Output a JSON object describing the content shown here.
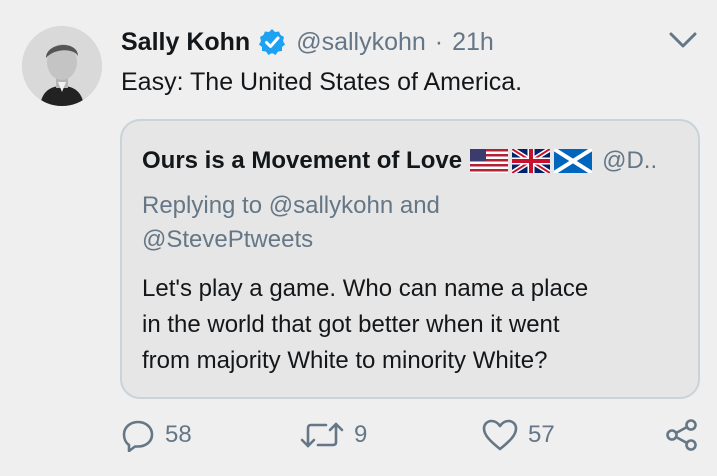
{
  "tweet": {
    "author_name": "Sally Kohn",
    "handle": "@sallykohn",
    "separator": "·",
    "time": "21h",
    "text": "Easy: The United States of America.",
    "verified_icon": "verified-badge-icon",
    "menu_icon": "chevron-down-icon"
  },
  "quoted": {
    "author_name": "Ours is a Movement of Love",
    "flags": [
      "us-flag-icon",
      "uk-flag-icon",
      "scotland-flag-icon"
    ],
    "handle": "@D..",
    "replying_prefix": "Replying to",
    "replying_to_1": "@sallykohn",
    "replying_and": "and",
    "replying_to_2": "@StevePtweets",
    "text_line_1": "Let's play a game.  Who can name a place",
    "text_line_2": "in the world that got better when it went",
    "text_line_3": "from majority White to minority White?"
  },
  "actions": {
    "reply_count": "58",
    "retweet_count": "9",
    "like_count": "57",
    "icons": [
      "reply-icon",
      "retweet-icon",
      "like-icon",
      "share-icon"
    ]
  },
  "colors": {
    "background": "#efefef",
    "quote_background": "#e6e6e6",
    "secondary_text": "#657786",
    "verified_blue": "#1da1f2"
  }
}
